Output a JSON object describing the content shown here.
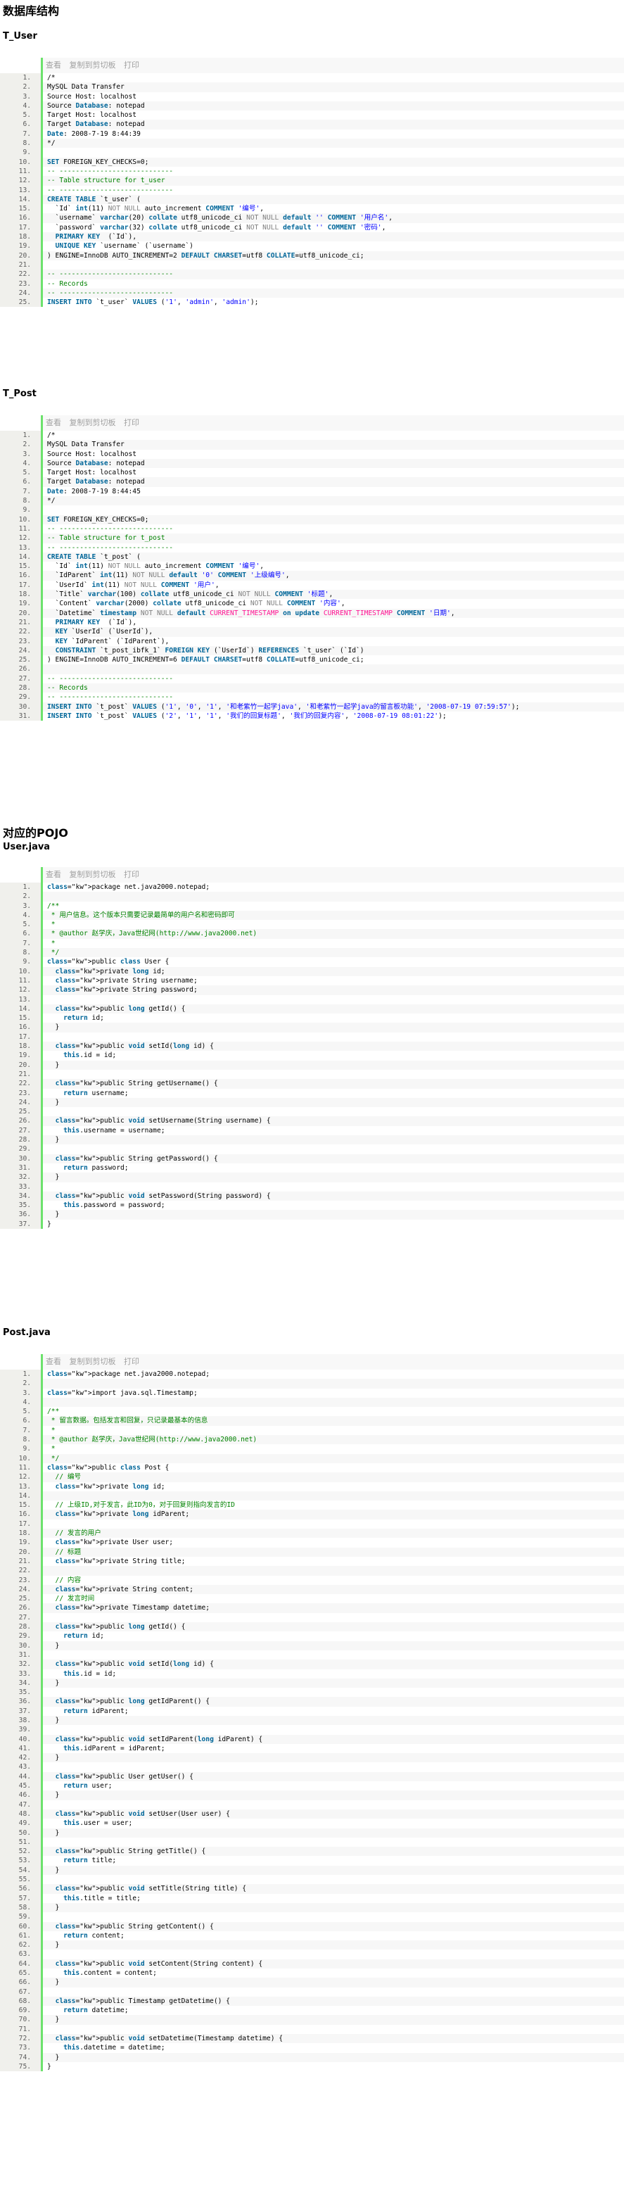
{
  "headings": {
    "db_structure": "数据库结构",
    "t_user": "T_User",
    "t_post": "T_Post",
    "pojo": "对应的POJO",
    "user_java": "User.java",
    "post_java": "Post.java"
  },
  "toolbar": {
    "view": "查看",
    "copy": "复制到剪切板",
    "print": "打印"
  },
  "blocks": {
    "t_user": [
      "/*",
      "MySQL Data Transfer",
      "Source Host: localhost",
      "Source Database: notepad",
      "Target Host: localhost",
      "Target Database: notepad",
      "Date: 2008-7-19 8:44:39",
      "*/",
      "",
      "SET FOREIGN_KEY_CHECKS=0;",
      "-- ----------------------------",
      "-- Table structure for t_user",
      "-- ----------------------------",
      "CREATE TABLE `t_user` (",
      "  `Id` int(11) NOT NULL auto_increment COMMENT '编号',",
      "  `username` varchar(20) collate utf8_unicode_ci NOT NULL default '' COMMENT '用户名',",
      "  `password` varchar(32) collate utf8_unicode_ci NOT NULL default '' COMMENT '密码',",
      "  PRIMARY KEY  (`Id`),",
      "  UNIQUE KEY `username` (`username`)",
      ") ENGINE=InnoDB AUTO_INCREMENT=2 DEFAULT CHARSET=utf8 COLLATE=utf8_unicode_ci;",
      "",
      "-- ----------------------------",
      "-- Records",
      "-- ----------------------------",
      "INSERT INTO `t_user` VALUES ('1', 'admin', 'admin');"
    ],
    "t_post": [
      "/*",
      "MySQL Data Transfer",
      "Source Host: localhost",
      "Source Database: notepad",
      "Target Host: localhost",
      "Target Database: notepad",
      "Date: 2008-7-19 8:44:45",
      "*/",
      "",
      "SET FOREIGN_KEY_CHECKS=0;",
      "-- ----------------------------",
      "-- Table structure for t_post",
      "-- ----------------------------",
      "CREATE TABLE `t_post` (",
      "  `Id` int(11) NOT NULL auto_increment COMMENT '编号',",
      "  `IdParent` int(11) NOT NULL default '0' COMMENT '上级编号',",
      "  `UserId` int(11) NOT NULL COMMENT '用户',",
      "  `Title` varchar(100) collate utf8_unicode_ci NOT NULL COMMENT '标题',",
      "  `Content` varchar(2000) collate utf8_unicode_ci NOT NULL COMMENT '内容',",
      "  `Datetime` timestamp NOT NULL default CURRENT_TIMESTAMP on update CURRENT_TIMESTAMP COMMENT '日期',",
      "  PRIMARY KEY  (`Id`),",
      "  KEY `UserId` (`UserId`),",
      "  KEY `IdParent` (`IdParent`),",
      "  CONSTRAINT `t_post_ibfk_1` FOREIGN KEY (`UserId`) REFERENCES `t_user` (`Id`)",
      ") ENGINE=InnoDB AUTO_INCREMENT=6 DEFAULT CHARSET=utf8 COLLATE=utf8_unicode_ci;",
      "",
      "-- ----------------------------",
      "-- Records",
      "-- ----------------------------",
      "INSERT INTO `t_post` VALUES ('1', '0', '1', '和老紫竹一起学java', '和老紫竹一起学java的留言板功能', '2008-07-19 07:59:57');",
      "INSERT INTO `t_post` VALUES ('2', '1', '1', '我们的回复标题', '我们的回复内容', '2008-07-19 08:01:22');"
    ],
    "user_java": [
      "package net.java2000.notepad;",
      "",
      "/**",
      " * 用户信息。这个版本只需要记录最简单的用户名和密码即可",
      " * ",
      " * @author 赵学庆，Java世纪网(http://www.java2000.net)",
      " * ",
      " */",
      "public class User {",
      "  private long id;",
      "  private String username;",
      "  private String password;",
      "",
      "  public long getId() {",
      "    return id;",
      "  }",
      "",
      "  public void setId(long id) {",
      "    this.id = id;",
      "  }",
      "",
      "  public String getUsername() {",
      "    return username;",
      "  }",
      "",
      "  public void setUsername(String username) {",
      "    this.username = username;",
      "  }",
      "",
      "  public String getPassword() {",
      "    return password;",
      "  }",
      "",
      "  public void setPassword(String password) {",
      "    this.password = password;",
      "  }",
      "}"
    ],
    "post_java": [
      "package net.java2000.notepad;",
      "",
      "import java.sql.Timestamp;",
      "",
      "/**",
      " * 留言数据。包括发言和回复，只记录最基本的信息",
      " * ",
      " * @author 赵学庆，Java世纪网(http://www.java2000.net)",
      " * ",
      " */",
      "public class Post {",
      "  // 编号",
      "  private long id;",
      "",
      "  // 上级ID,对于发言，此ID为0，对于回复则指向发言的ID",
      "  private long idParent;",
      "",
      "  // 发言的用户",
      "  private User user;",
      "  // 标题",
      "  private String title;",
      "",
      "  // 内容",
      "  private String content;",
      "  // 发言时间",
      "  private Timestamp datetime;",
      "",
      "  public long getId() {",
      "    return id;",
      "  }",
      "",
      "  public void setId(long id) {",
      "    this.id = id;",
      "  }",
      "",
      "  public long getIdParent() {",
      "    return idParent;",
      "  }",
      "",
      "  public void setIdParent(long idParent) {",
      "    this.idParent = idParent;",
      "  }",
      "",
      "  public User getUser() {",
      "    return user;",
      "  }",
      "",
      "  public void setUser(User user) {",
      "    this.user = user;",
      "  }",
      "",
      "  public String getTitle() {",
      "    return title;",
      "  }",
      "",
      "  public void setTitle(String title) {",
      "    this.title = title;",
      "  }",
      "",
      "  public String getContent() {",
      "    return content;",
      "  }",
      "",
      "  public void setContent(String content) {",
      "    this.content = content;",
      "  }",
      "",
      "  public Timestamp getDatetime() {",
      "    return datetime;",
      "  }",
      "",
      "  public void setDatetime(Timestamp datetime) {",
      "    this.datetime = datetime;",
      "  }",
      "}"
    ]
  }
}
